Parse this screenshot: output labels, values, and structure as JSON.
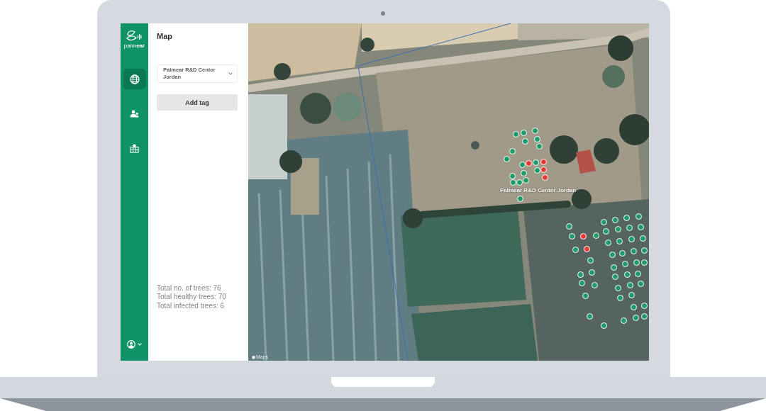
{
  "sidebar": {
    "logo": "palm**ear**",
    "nav_items": [
      {
        "selected": true
      },
      {
        "selected": false
      },
      {
        "selected": false
      }
    ]
  },
  "panel": {
    "title": "Map",
    "site_select": {
      "value": "Palmear R&D Center Jordan"
    },
    "add_tag_button": "Add tag",
    "stats": [
      "Total no. of trees: 76",
      "Total healthy trees: 70",
      "Total infected trees: 6"
    ]
  },
  "map": {
    "site_label": "Palmear R&D Center Jordan",
    "attribution": "Maps",
    "markers": [
      {
        "color": "#1e9a6b"
      },
      {
        "color": "#1e9a6b"
      },
      {
        "color": "#1e9a6b"
      },
      {
        "color": "#1e9a6b"
      },
      {
        "color": "#1e9a6b"
      },
      {
        "color": "#1e9a6b"
      },
      {
        "color": "#1e9a6b"
      },
      {
        "color": "#1e9a6b"
      },
      {
        "color": "#1e9a6b"
      },
      {
        "color": "#e53935"
      },
      {
        "color": "#1e9a6b"
      },
      {
        "color": "#e53935"
      },
      {
        "color": "#1e9a6b"
      },
      {
        "color": "#e53935"
      },
      {
        "color": "#e53935"
      },
      {
        "color": "#1e9a6b"
      },
      {
        "color": "#1e9a6b"
      },
      {
        "color": "#1e9a6b"
      },
      {
        "color": "#1e9a6b"
      },
      {
        "color": "#1e9a6b"
      },
      {
        "color": "#1e9a6b"
      },
      {
        "color": "#1e9a6b"
      },
      {
        "color": "#1e9a6b"
      },
      {
        "color": "#e53935"
      },
      {
        "color": "#1e9a6b"
      },
      {
        "color": "#1e9a6b"
      },
      {
        "color": "#e53935"
      },
      {
        "color": "#1e9a6b"
      },
      {
        "color": "#1e9a6b"
      },
      {
        "color": "#1e9a6b"
      },
      {
        "color": "#1e9a6b"
      },
      {
        "color": "#1e9a6b"
      },
      {
        "color": "#1e9a6b"
      },
      {
        "color": "#1e9a6b"
      },
      {
        "color": "#1e9a6b"
      },
      {
        "color": "#1e9a6b"
      },
      {
        "color": "#1e9a6b"
      },
      {
        "color": "#1e9a6b"
      },
      {
        "color": "#1e9a6b"
      },
      {
        "color": "#1e9a6b"
      },
      {
        "color": "#1e9a6b"
      },
      {
        "color": "#1e9a6b"
      },
      {
        "color": "#1e9a6b"
      },
      {
        "color": "#1e9a6b"
      },
      {
        "color": "#1e9a6b"
      },
      {
        "color": "#1e9a6b"
      },
      {
        "color": "#1e9a6b"
      },
      {
        "color": "#1e9a6b"
      },
      {
        "color": "#1e9a6b"
      },
      {
        "color": "#1e9a6b"
      },
      {
        "color": "#1e9a6b"
      },
      {
        "color": "#1e9a6b"
      },
      {
        "color": "#1e9a6b"
      },
      {
        "color": "#1e9a6b"
      },
      {
        "color": "#1e9a6b"
      },
      {
        "color": "#1e9a6b"
      },
      {
        "color": "#1e9a6b"
      },
      {
        "color": "#1e9a6b"
      },
      {
        "color": "#1e9a6b"
      },
      {
        "color": "#1e9a6b"
      },
      {
        "color": "#1e9a6b"
      },
      {
        "color": "#1e9a6b"
      },
      {
        "color": "#1e9a6b"
      },
      {
        "color": "#1e9a6b"
      },
      {
        "color": "#1e9a6b"
      },
      {
        "color": "#1e9a6b"
      },
      {
        "color": "#1e9a6b"
      },
      {
        "color": "#1e9a6b"
      }
    ]
  }
}
